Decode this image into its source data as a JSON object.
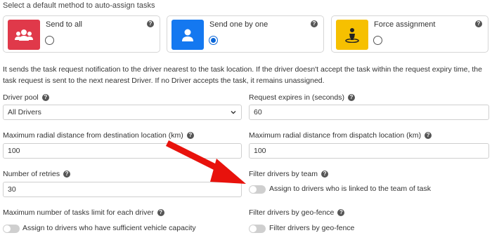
{
  "heading": "Select a default method to auto-assign tasks",
  "methods": [
    {
      "label": "Send to all",
      "color": "#e0394a",
      "icon": "users-icon",
      "selected": false
    },
    {
      "label": "Send one by one",
      "color": "#1478f0",
      "icon": "user-icon",
      "selected": true
    },
    {
      "label": "Force assignment",
      "color": "#f6c000",
      "icon": "person-pin-icon",
      "selected": false
    }
  ],
  "description": "It sends the task request notification to the driver nearest to the task location. If the driver doesn't accept the task within the request expiry time, the task request is sent to the next nearest Driver. If no Driver accepts the task, it remains unassigned.",
  "fields": {
    "driver_pool": {
      "label": "Driver pool",
      "value": "All Drivers"
    },
    "request_expires": {
      "label": "Request expires in (seconds)",
      "value": "60"
    },
    "max_radial_destination": {
      "label": "Maximum radial distance from destination location (km)",
      "value": "100"
    },
    "max_radial_dispatch": {
      "label": "Maximum radial distance from dispatch location (km)",
      "value": "100"
    },
    "retries": {
      "label": "Number of retries",
      "value": "30"
    },
    "filter_team": {
      "label": "Filter drivers by team",
      "toggle_label": "Assign to drivers who is linked to the team of task"
    },
    "max_tasks": {
      "label": "Maximum number of tasks limit for each driver",
      "toggle_label": "Assign to drivers who have sufficient vehicle capacity"
    },
    "geo_fence": {
      "label": "Filter drivers by geo-fence",
      "toggle_label": "Filter drivers by geo-fence"
    }
  },
  "help_glyph": "?",
  "arrow_color": "#e8120c"
}
